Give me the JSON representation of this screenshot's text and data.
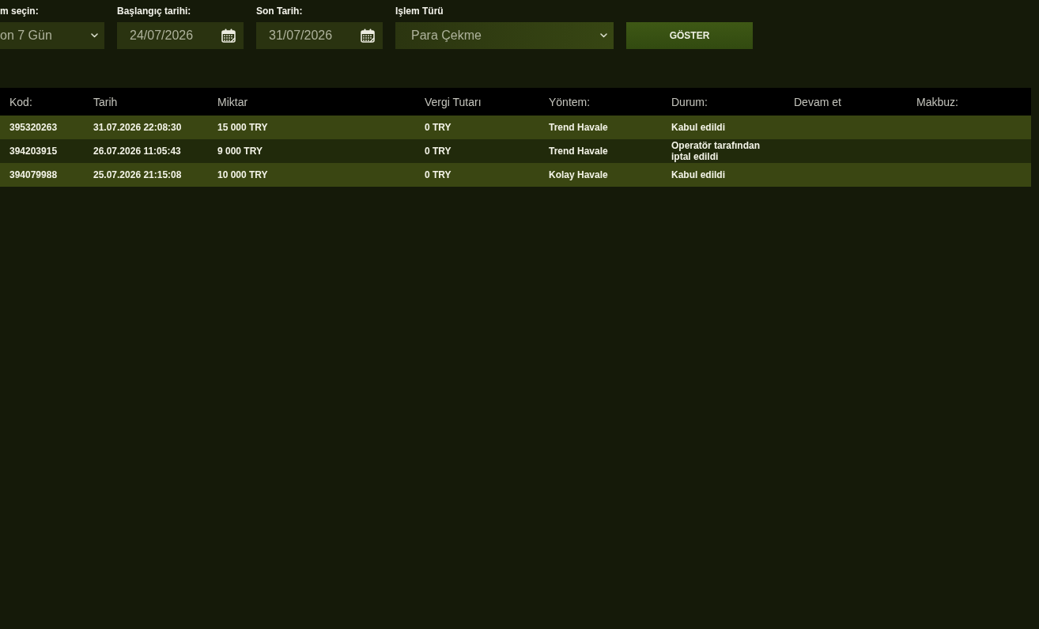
{
  "filters": [
    {
      "kind": "select",
      "label": "m seçin:",
      "value": "on 7 Gün"
    },
    {
      "kind": "date",
      "label": "Başlangıç tarihi:",
      "value": "24/07/2026"
    },
    {
      "kind": "date",
      "label": "Son Tarih:",
      "value": "31/07/2026"
    },
    {
      "kind": "select",
      "label": "Işlem Türü",
      "value": "Para Çekme"
    }
  ],
  "show_button": {
    "label": "GÖSTER"
  },
  "table": {
    "columns": [
      "Kod:",
      "Tarih",
      "Miktar",
      "Vergi Tutarı",
      "Yöntem:",
      "Durum:",
      "Devam et",
      "Makbuz:"
    ],
    "rows": [
      {
        "cells": [
          "395320263",
          "31.07.2026 22:08:30",
          "15 000 TRY",
          "0 TRY",
          "Trend Havale",
          "Kabul edildi"
        ]
      },
      {
        "cells": [
          "394203915",
          "26.07.2026 11:05:43",
          "9 000 TRY",
          "0 TRY",
          "Trend Havale",
          "Operatör tarafından iptal edildi"
        ]
      },
      {
        "cells": [
          "394079988",
          "25.07.2026 21:15:08",
          "10 000 TRY",
          "0 TRY",
          "Kolay Havale",
          "Kabul edildi"
        ]
      }
    ]
  }
}
